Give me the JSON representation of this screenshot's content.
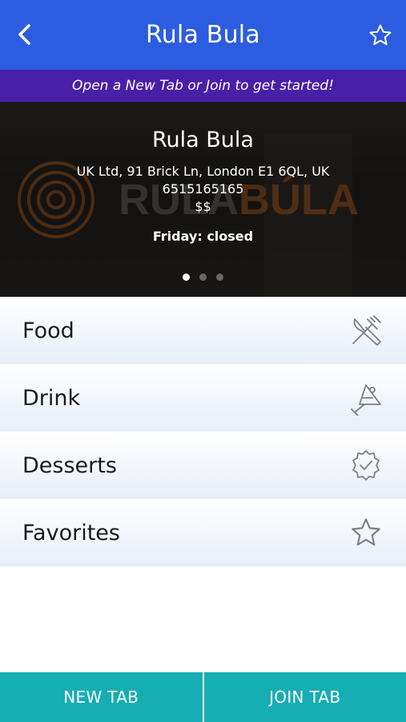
{
  "header": {
    "title": "Rula Bula",
    "back_icon": "chevron-left-icon",
    "favorite_icon": "star-outline-icon",
    "background_color": "#2c5ce0"
  },
  "banner": {
    "text": "Open a New Tab or Join to get started!",
    "background_color": "#4a1fa8"
  },
  "hero": {
    "name": "Rula Bula",
    "address": "UK Ltd, 91 Brick Ln, London E1 6QL, UK",
    "phone": "6515165165",
    "price_level": "$$",
    "hours": "Friday: closed",
    "background_logo_text": "RULABÚLA",
    "carousel": {
      "count": 3,
      "active_index": 0
    }
  },
  "menu": {
    "items": [
      {
        "label": "Food",
        "icon": "fork-knife-icon"
      },
      {
        "label": "Drink",
        "icon": "cocktail-glass-icon"
      },
      {
        "label": "Desserts",
        "icon": "badge-check-icon"
      },
      {
        "label": "Favorites",
        "icon": "star-outline-icon"
      }
    ]
  },
  "footer": {
    "new_tab_label": "NEW TAB",
    "join_tab_label": "JOIN TAB",
    "background_color": "#15aeb3"
  }
}
